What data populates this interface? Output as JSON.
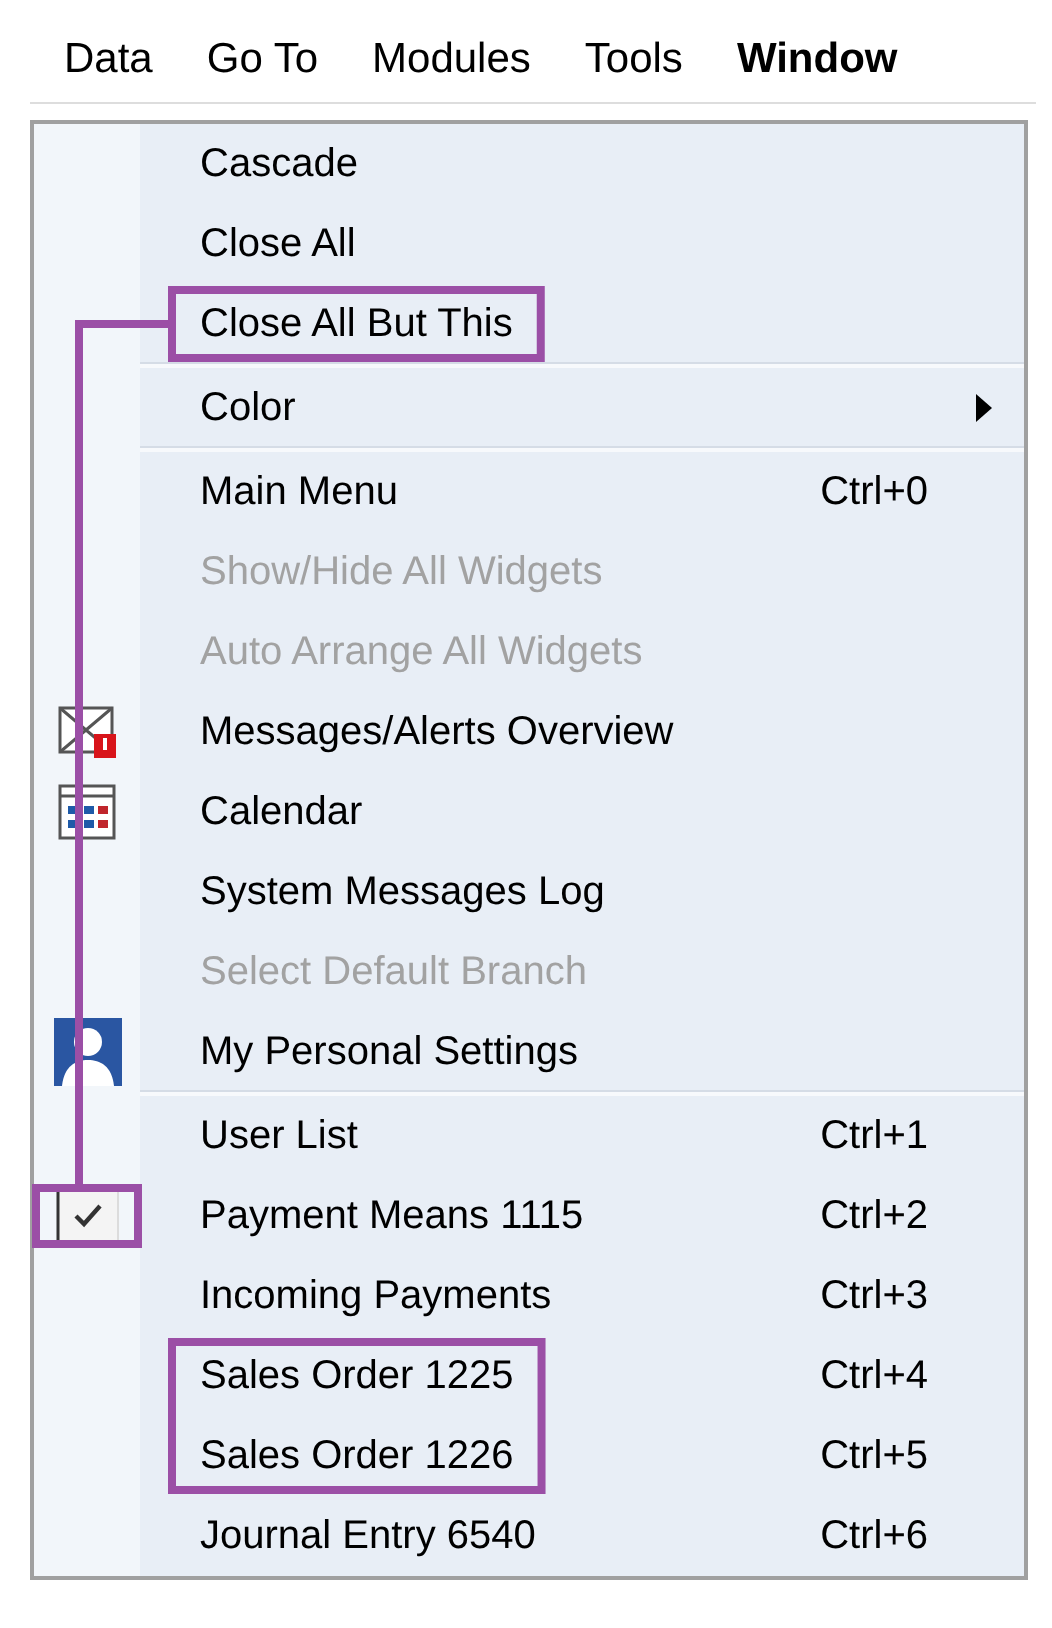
{
  "menu_bar": [
    {
      "label": "Data",
      "selected": false
    },
    {
      "label": "Go To",
      "selected": false
    },
    {
      "label": "Modules",
      "selected": false
    },
    {
      "label": "Tools",
      "selected": false
    },
    {
      "label": "Window",
      "selected": true
    }
  ],
  "callout_line": true,
  "sections": [
    {
      "items": [
        {
          "label": "Cascade",
          "kind": "plain",
          "disabled": false,
          "checked": false,
          "highlighted": false
        },
        {
          "label": "Close All",
          "kind": "plain",
          "disabled": false,
          "checked": false,
          "highlighted": false
        },
        {
          "label": "Close All But This",
          "kind": "plain",
          "disabled": false,
          "checked": false,
          "highlighted": true
        }
      ]
    },
    {
      "items": [
        {
          "label": "Color",
          "kind": "submenu",
          "disabled": false,
          "checked": false,
          "highlighted": false
        }
      ]
    },
    {
      "items": [
        {
          "label": "Main Menu",
          "kind": "plain",
          "shortcut": "Ctrl+0",
          "disabled": false,
          "checked": false,
          "highlighted": false
        },
        {
          "label": "Show/Hide All Widgets",
          "kind": "plain",
          "disabled": true,
          "checked": false,
          "highlighted": false
        },
        {
          "label": "Auto Arrange All Widgets",
          "kind": "plain",
          "disabled": true,
          "checked": false,
          "highlighted": false
        },
        {
          "label": "Messages/Alerts Overview",
          "kind": "messages",
          "disabled": false,
          "checked": false,
          "highlighted": false
        },
        {
          "label": "Calendar",
          "kind": "calendar",
          "disabled": false,
          "checked": false,
          "highlighted": false
        },
        {
          "label": "System Messages Log",
          "kind": "plain",
          "disabled": false,
          "checked": false,
          "highlighted": false
        },
        {
          "label": "Select Default Branch",
          "kind": "plain",
          "disabled": true,
          "checked": false,
          "highlighted": false
        },
        {
          "label": "My Personal Settings",
          "kind": "settings",
          "disabled": false,
          "checked": false,
          "highlighted": false
        }
      ]
    },
    {
      "items": [
        {
          "label": "User List",
          "kind": "plain",
          "shortcut": "Ctrl+1",
          "disabled": false,
          "checked": false,
          "highlighted": false
        },
        {
          "label": "Payment Means 1115",
          "kind": "plain",
          "shortcut": "Ctrl+2",
          "disabled": false,
          "checked": true,
          "highlighted": false
        },
        {
          "label": "Incoming Payments",
          "kind": "plain",
          "shortcut": "Ctrl+3",
          "disabled": false,
          "checked": false,
          "highlighted": false
        },
        {
          "label": "Sales Order 1225",
          "kind": "plain",
          "shortcut": "Ctrl+4",
          "disabled": false,
          "checked": false,
          "highlighted": true
        },
        {
          "label": "Sales Order 1226",
          "kind": "plain",
          "shortcut": "Ctrl+5",
          "disabled": false,
          "checked": false,
          "highlighted": true
        },
        {
          "label": "Journal Entry 6540",
          "kind": "plain",
          "shortcut": "Ctrl+6",
          "disabled": false,
          "checked": false,
          "highlighted": false
        }
      ]
    }
  ]
}
